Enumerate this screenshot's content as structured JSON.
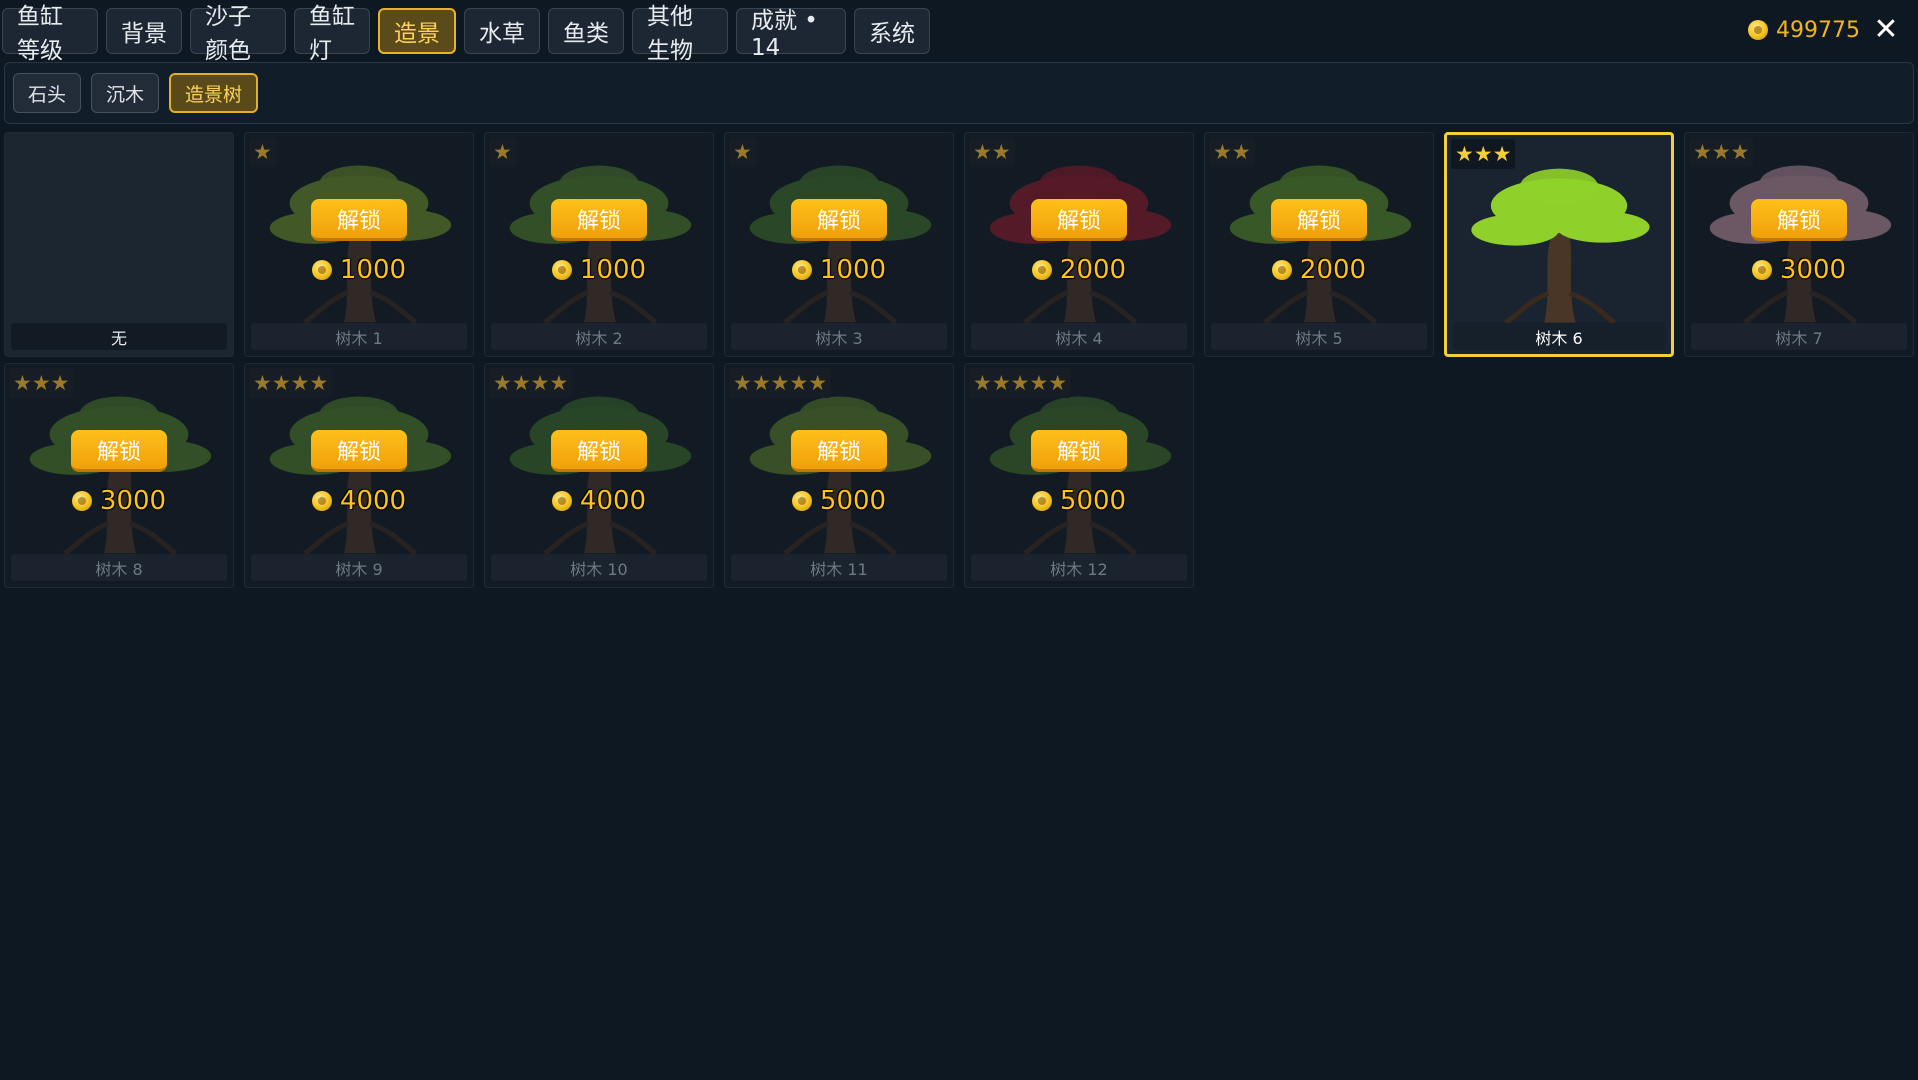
{
  "tabs": [
    {
      "label": "鱼缸等级"
    },
    {
      "label": "背景"
    },
    {
      "label": "沙子颜色"
    },
    {
      "label": "鱼缸灯"
    },
    {
      "label": "造景"
    },
    {
      "label": "水草"
    },
    {
      "label": "鱼类"
    },
    {
      "label": "其他生物"
    },
    {
      "label": "成就 • 14"
    },
    {
      "label": "系统"
    }
  ],
  "active_tab": "造景",
  "coins": {
    "amount": "499775"
  },
  "close_icon": "close-icon",
  "subtabs": [
    {
      "label": "石头"
    },
    {
      "label": "沉木"
    },
    {
      "label": "造景树"
    }
  ],
  "active_subtab": "造景树",
  "unlock_label": "解锁",
  "items": [
    {
      "name": "无",
      "stars": "",
      "price": "",
      "state": "empty"
    },
    {
      "name": "树木 1",
      "stars": "★",
      "price": "1000",
      "state": "locked",
      "color": "#6a8a2a"
    },
    {
      "name": "树木 2",
      "stars": "★",
      "price": "1000",
      "state": "locked",
      "color": "#4f7a2c"
    },
    {
      "name": "树木 3",
      "stars": "★",
      "price": "1000",
      "state": "locked",
      "color": "#3f6e2a"
    },
    {
      "name": "树木 4",
      "stars": "★★",
      "price": "2000",
      "state": "locked",
      "color": "#8c1a2a"
    },
    {
      "name": "树木 5",
      "stars": "★★",
      "price": "2000",
      "state": "locked",
      "color": "#5a8a2a"
    },
    {
      "name": "树木 6",
      "stars": "★★★",
      "price": "",
      "state": "selected",
      "color": "#8fd12a"
    },
    {
      "name": "树木 7",
      "stars": "★★★",
      "price": "3000",
      "state": "locked",
      "color": "#b48a9a"
    },
    {
      "name": "树木 8",
      "stars": "★★★",
      "price": "3000",
      "state": "locked",
      "color": "#4e7a2a"
    },
    {
      "name": "树木 9",
      "stars": "★★★★",
      "price": "4000",
      "state": "locked",
      "color": "#4e7a2a"
    },
    {
      "name": "树木 10",
      "stars": "★★★★",
      "price": "4000",
      "state": "locked",
      "color": "#3a6a2a"
    },
    {
      "name": "树木 11",
      "stars": "★★★★★",
      "price": "5000",
      "state": "locked",
      "color": "#5a7a2a"
    },
    {
      "name": "树木 12",
      "stars": "★★★★★",
      "price": "5000",
      "state": "locked",
      "color": "#3e6a2a"
    }
  ]
}
